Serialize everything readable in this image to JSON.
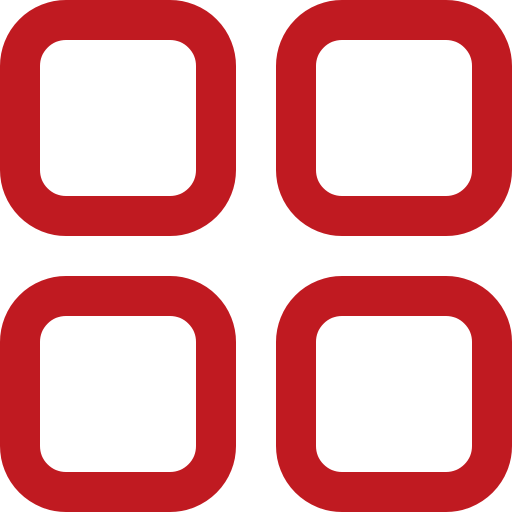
{
  "icon": {
    "name": "grid-view-icon",
    "color": "#c01a21",
    "tiles": [
      "top-left",
      "top-right",
      "bottom-left",
      "bottom-right"
    ]
  }
}
